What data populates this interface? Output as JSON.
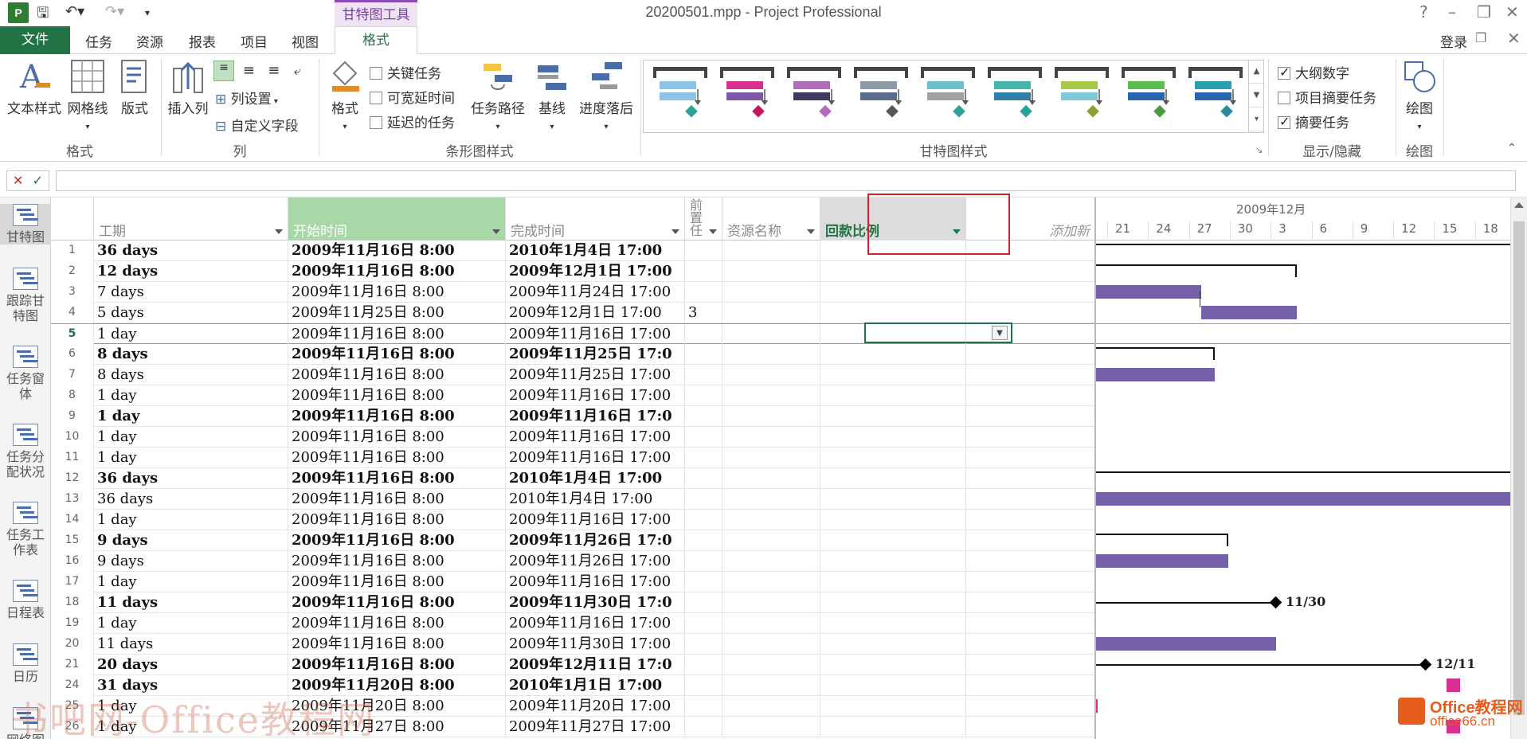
{
  "window": {
    "title": "20200501.mpp - Project Professional",
    "app_logo": "P",
    "context_tab": "甘特图工具",
    "help": "?"
  },
  "ribbon_tabs": {
    "file": "文件",
    "tabs": [
      "任务",
      "资源",
      "报表",
      "项目",
      "视图"
    ],
    "active": "格式",
    "login": "登录"
  },
  "ribbon": {
    "groups": {
      "format": "格式",
      "columns": "列",
      "bar_styles": "条形图样式",
      "gantt_styles": "甘特图样式",
      "show_hide": "显示/隐藏",
      "drawing": "绘图"
    },
    "text_styles": "文本样式",
    "gridlines": "网格线",
    "layout": "版式",
    "insert_column": "插入列",
    "column_settings": "列设置",
    "custom_fields": "自定义字段",
    "format": "格式",
    "critical_tasks": "关键任务",
    "slack": "可宽延时间",
    "late_tasks": "延迟的任务",
    "task_path": "任务路径",
    "baseline": "基线",
    "slippage": "进度落后",
    "outline_number": "大纲数字",
    "project_summary": "项目摘要任务",
    "summary_tasks": "摘要任务",
    "drawing": "绘图",
    "checks": {
      "critical": false,
      "slack": false,
      "late": false,
      "outline": true,
      "project_summary": false,
      "summary": true
    },
    "gallery_colors": [
      [
        "#8ec3e8",
        "#8ec3e8",
        "#2aa198"
      ],
      [
        "#d62f8f",
        "#7e57a8",
        "#c2185b"
      ],
      [
        "#b36bbb",
        "#3f3a60",
        "#b36bbb"
      ],
      [
        "#8e99a8",
        "#5a6e8c",
        "#555555"
      ],
      [
        "#6fc0cf",
        "#a0a0a0",
        "#30a09a"
      ],
      [
        "#44b5a8",
        "#2f7fa8",
        "#2aa198"
      ],
      [
        "#a8c84a",
        "#7fc8d8",
        "#8aa030"
      ],
      [
        "#5bbf50",
        "#2a66b0",
        "#4a9a40"
      ],
      [
        "#2a9fb0",
        "#2a66b0",
        "#2a8aa0"
      ]
    ]
  },
  "formula_bar": {
    "cancel": "✕",
    "enter": "✓",
    "value": ""
  },
  "views": [
    {
      "label": "甘特图",
      "active": true
    },
    {
      "label": "跟踪甘特图",
      "active": false
    },
    {
      "label": "任务窗体",
      "active": false
    },
    {
      "label": "任务分配状况",
      "active": false
    },
    {
      "label": "任务工作表",
      "active": false
    },
    {
      "label": "日程表",
      "active": false
    },
    {
      "label": "日历",
      "active": false
    },
    {
      "label": "网络图",
      "active": false
    }
  ],
  "columns": {
    "duration": "工期",
    "start": "开始时间",
    "finish": "完成时间",
    "predecessors": "前置任",
    "resource": "资源名称",
    "payment_ratio": "回款比例",
    "add_new": "添加新"
  },
  "rows": [
    {
      "id": "1",
      "duration": "36 days",
      "start": "2009年11月16日 8:00",
      "finish": "2010年1月4日 17:00",
      "pred": "",
      "summary": true
    },
    {
      "id": "2",
      "duration": "12 days",
      "start": "2009年11月16日 8:00",
      "finish": "2009年12月1日 17:00",
      "pred": "",
      "summary": true
    },
    {
      "id": "3",
      "duration": "7 days",
      "start": "2009年11月16日 8:00",
      "finish": "2009年11月24日 17:00",
      "pred": "",
      "summary": false
    },
    {
      "id": "4",
      "duration": "5 days",
      "start": "2009年11月25日 8:00",
      "finish": "2009年12月1日 17:00",
      "pred": "3",
      "summary": false
    },
    {
      "id": "5",
      "duration": "1 day",
      "start": "2009年11月16日 8:00",
      "finish": "2009年11月16日 17:00",
      "pred": "",
      "summary": false
    },
    {
      "id": "6",
      "duration": "8 days",
      "start": "2009年11月16日 8:00",
      "finish": "2009年11月25日 17:0",
      "pred": "",
      "summary": true
    },
    {
      "id": "7",
      "duration": "8 days",
      "start": "2009年11月16日 8:00",
      "finish": "2009年11月25日 17:00",
      "pred": "",
      "summary": false
    },
    {
      "id": "8",
      "duration": "1 day",
      "start": "2009年11月16日 8:00",
      "finish": "2009年11月16日 17:00",
      "pred": "",
      "summary": false
    },
    {
      "id": "9",
      "duration": "1 day",
      "start": "2009年11月16日 8:00",
      "finish": "2009年11月16日 17:0",
      "pred": "",
      "summary": true
    },
    {
      "id": "10",
      "duration": "1 day",
      "start": "2009年11月16日 8:00",
      "finish": "2009年11月16日 17:00",
      "pred": "",
      "summary": false
    },
    {
      "id": "11",
      "duration": "1 day",
      "start": "2009年11月16日 8:00",
      "finish": "2009年11月16日 17:00",
      "pred": "",
      "summary": false
    },
    {
      "id": "12",
      "duration": "36 days",
      "start": "2009年11月16日 8:00",
      "finish": "2010年1月4日 17:00",
      "pred": "",
      "summary": true
    },
    {
      "id": "13",
      "duration": "36 days",
      "start": "2009年11月16日 8:00",
      "finish": "2010年1月4日 17:00",
      "pred": "",
      "summary": false
    },
    {
      "id": "14",
      "duration": "1 day",
      "start": "2009年11月16日 8:00",
      "finish": "2009年11月16日 17:00",
      "pred": "",
      "summary": false
    },
    {
      "id": "15",
      "duration": "9 days",
      "start": "2009年11月16日 8:00",
      "finish": "2009年11月26日 17:0",
      "pred": "",
      "summary": true
    },
    {
      "id": "16",
      "duration": "9 days",
      "start": "2009年11月16日 8:00",
      "finish": "2009年11月26日 17:00",
      "pred": "",
      "summary": false
    },
    {
      "id": "17",
      "duration": "1 day",
      "start": "2009年11月16日 8:00",
      "finish": "2009年11月16日 17:00",
      "pred": "",
      "summary": false
    },
    {
      "id": "18",
      "duration": "11 days",
      "start": "2009年11月16日 8:00",
      "finish": "2009年11月30日 17:0",
      "pred": "",
      "summary": true
    },
    {
      "id": "19",
      "duration": "1 day",
      "start": "2009年11月16日 8:00",
      "finish": "2009年11月16日 17:00",
      "pred": "",
      "summary": false
    },
    {
      "id": "20",
      "duration": "11 days",
      "start": "2009年11月16日 8:00",
      "finish": "2009年11月30日 17:00",
      "pred": "",
      "summary": false
    },
    {
      "id": "21",
      "duration": "20 days",
      "start": "2009年11月16日 8:00",
      "finish": "2009年12月11日 17:0",
      "pred": "",
      "summary": true
    },
    {
      "id": "24",
      "duration": "31 days",
      "start": "2009年11月20日 8:00",
      "finish": "2010年1月1日 17:00",
      "pred": "",
      "summary": true
    },
    {
      "id": "25",
      "duration": "1 day",
      "start": "2009年11月20日 8:00",
      "finish": "2009年11月20日 17:00",
      "pred": "",
      "summary": false
    },
    {
      "id": "26",
      "duration": "1 day",
      "start": "2009年11月27日 8:00",
      "finish": "2009年11月27日 17:00",
      "pred": "",
      "summary": false
    }
  ],
  "gantt": {
    "month": "2009年12月",
    "ticks": [
      "21",
      "24",
      "27",
      "30",
      "3",
      "6",
      "9",
      "12",
      "15",
      "18"
    ],
    "milestone_labels": {
      "m18": "11/30",
      "m21": "12/11"
    },
    "colors": {
      "task": "#7461a7",
      "recurring": "#d62f8f"
    }
  },
  "watermarks": {
    "left": "书吧网-Office教程网",
    "right_title": "Office教程网",
    "right_url": "office66.cn"
  }
}
